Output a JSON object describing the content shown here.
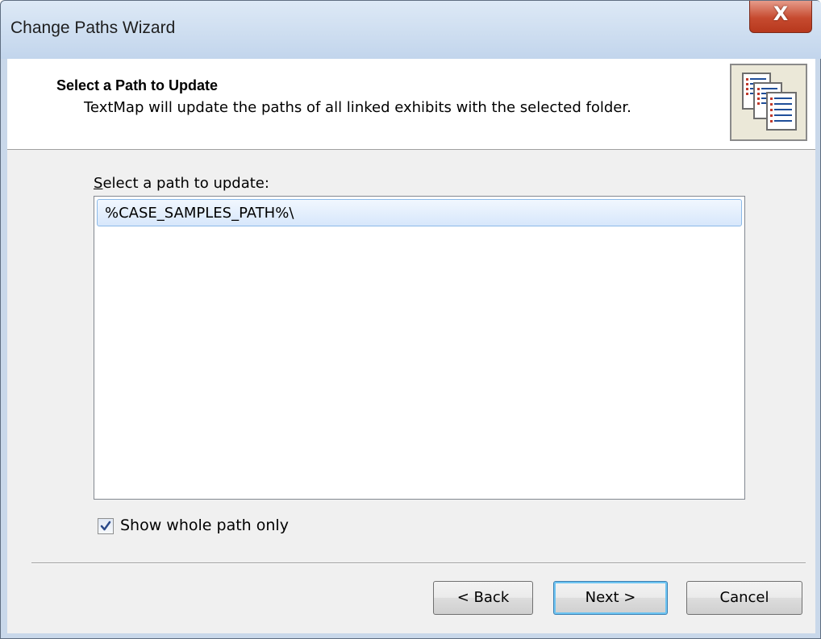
{
  "window": {
    "title": "Change Paths Wizard",
    "close_label": "X"
  },
  "header": {
    "title": "Select a Path to Update",
    "description": "TextMap will update the paths of all linked exhibits with the selected folder.",
    "icon": "documents-stack-icon"
  },
  "path_list": {
    "label_access_key": "S",
    "label_rest": "elect a path to update:",
    "items": [
      "%CASE_SAMPLES_PATH%\\"
    ],
    "selected_index": 0
  },
  "show_whole_path_only": {
    "label": "Show whole path only",
    "checked": true
  },
  "buttons": {
    "back": "< Back",
    "next": "Next >",
    "cancel": "Cancel"
  },
  "colors": {
    "selection_border": "#8bb9e8",
    "default_button_glow": "#6dc4f2",
    "close_button": "#c64a2f"
  }
}
